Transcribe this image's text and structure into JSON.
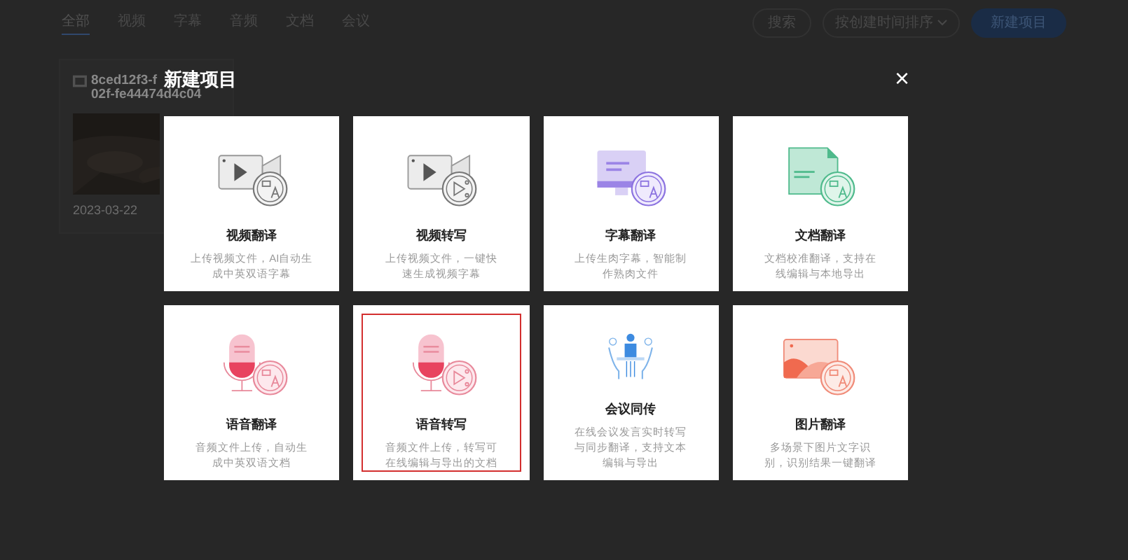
{
  "nav": {
    "tabs": [
      {
        "label": "全部",
        "selected": true
      },
      {
        "label": "视频",
        "selected": false
      },
      {
        "label": "字幕",
        "selected": false
      },
      {
        "label": "音频",
        "selected": false
      },
      {
        "label": "文档",
        "selected": false
      },
      {
        "label": "会议",
        "selected": false
      }
    ],
    "search": "搜索",
    "sort": "按创建时间排序",
    "new_button": "新建项目"
  },
  "project_card": {
    "name_lines": [
      "8ced12f3-f",
      "02f-fe44474d4c04"
    ],
    "date": "2023-03-22"
  },
  "dialog": {
    "title": "新建项目",
    "close": "×",
    "cards": [
      {
        "kind": "video-translate",
        "title": "视频翻译",
        "description": "上传视频文件，AI自动生成中英双语字幕",
        "selected": false
      },
      {
        "kind": "video-transcribe",
        "title": "视频转写",
        "description": "上传视频文件，一键快速生成视频字幕",
        "selected": false
      },
      {
        "kind": "subtitle-translate",
        "title": "字幕翻译",
        "description": "上传生肉字幕，智能制作熟肉文件",
        "selected": false
      },
      {
        "kind": "document-translate",
        "title": "文档翻译",
        "description": "文档校准翻译，支持在线编辑与本地导出",
        "selected": false
      },
      {
        "kind": "audio-translate",
        "title": "语音翻译",
        "description": "音频文件上传，自动生成中英双语文档",
        "selected": false
      },
      {
        "kind": "audio-transcribe",
        "title": "语音转写",
        "description": "音频文件上传，转写可在线编辑与导出的文档",
        "selected": true
      },
      {
        "kind": "meeting",
        "title": "会议同传",
        "description": "在线会议发言实时转写与同步翻译，支持文本编辑与导出",
        "selected": false
      },
      {
        "kind": "image-translate",
        "title": "图片翻译",
        "description": "多场景下图片文字识别，识别结果一键翻译",
        "selected": false
      }
    ]
  }
}
